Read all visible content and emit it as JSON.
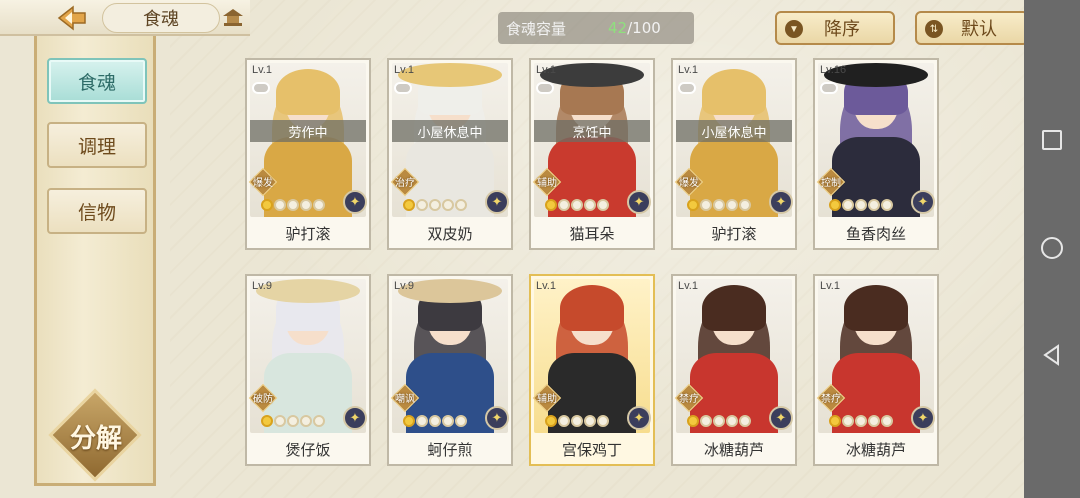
{
  "header": {
    "tab_title": "食魂",
    "capacity_label": "食魂容量",
    "capacity_current": "42",
    "capacity_total": "/100",
    "sort_label": "降序",
    "default_label": "默认"
  },
  "sidebar": {
    "items": [
      {
        "label": "食魂",
        "active": true
      },
      {
        "label": "调理",
        "active": false
      },
      {
        "label": "信物",
        "active": false
      }
    ],
    "decompose_label": "分解"
  },
  "cards": [
    {
      "level": "Lv.1",
      "status": "劳作中",
      "role": "爆发",
      "name": "驴打滚",
      "stars_filled": 1,
      "stars_total": 5,
      "hair": "#e6c06a",
      "outfit": "#d9a845",
      "gold": false,
      "hat": "none"
    },
    {
      "level": "Lv.1",
      "status": "小屋休息中",
      "role": "治疗",
      "name": "双皮奶",
      "stars_filled": 1,
      "stars_total": 5,
      "hair": "#efefea",
      "outfit": "#e9e7e0",
      "gold": false,
      "hat": "#e7c777"
    },
    {
      "level": "Lv.1",
      "status": "烹饪中",
      "role": "辅助",
      "name": "猫耳朵",
      "stars_filled": 1,
      "stars_total": 5,
      "hair": "#a77852",
      "outfit": "#c93a2e",
      "gold": false,
      "hat": "#3c3c3c"
    },
    {
      "level": "Lv.1",
      "status": "小屋休息中",
      "role": "爆发",
      "name": "驴打滚",
      "stars_filled": 1,
      "stars_total": 5,
      "hair": "#e6c06a",
      "outfit": "#d9a845",
      "gold": false,
      "hat": "none"
    },
    {
      "level": "Lv.16",
      "status": "",
      "role": "控制",
      "name": "鱼香肉丝",
      "stars_filled": 1,
      "stars_total": 5,
      "hair": "#6c5a9a",
      "outfit": "#2c2c3c",
      "gold": false,
      "hat": "#202020"
    },
    {
      "level": "Lv.9",
      "status": "",
      "role": "破防",
      "name": "煲仔饭",
      "stars_filled": 1,
      "stars_total": 5,
      "hair": "#e8e8ee",
      "outfit": "#d8e6de",
      "gold": false,
      "hat": "#e5d4a4"
    },
    {
      "level": "Lv.9",
      "status": "",
      "role": "嘲讽",
      "name": "蚵仔煎",
      "stars_filled": 1,
      "stars_total": 5,
      "hair": "#3d3a40",
      "outfit": "#2e4f8a",
      "gold": false,
      "hat": "#dcc69a"
    },
    {
      "level": "Lv.1",
      "status": "",
      "role": "辅助",
      "name": "宫保鸡丁",
      "stars_filled": 1,
      "stars_total": 5,
      "hair": "#c64a2c",
      "outfit": "#2a2a2a",
      "gold": true,
      "hat": "none"
    },
    {
      "level": "Lv.1",
      "status": "",
      "role": "禁疗",
      "name": "冰糖葫芦",
      "stars_filled": 1,
      "stars_total": 5,
      "hair": "#4a2c20",
      "outfit": "#c8362e",
      "gold": false,
      "hat": "none"
    },
    {
      "level": "Lv.1",
      "status": "",
      "role": "禁疗",
      "name": "冰糖葫芦",
      "stars_filled": 1,
      "stars_total": 5,
      "hair": "#4a2c20",
      "outfit": "#c8362e",
      "gold": false,
      "hat": "none"
    }
  ],
  "icons": {
    "back": "back-arrow-icon",
    "tab": "pagoda-icon",
    "sort": "sort-down-icon",
    "default": "filter-icon",
    "element": "element-icon",
    "chat": "chat-bubble-icon"
  },
  "colors": {
    "accent_teal": "#a8ddd6",
    "gold": "#e3be55",
    "star_filled": "#f3c93e",
    "capacity_green": "#8fe07e"
  }
}
